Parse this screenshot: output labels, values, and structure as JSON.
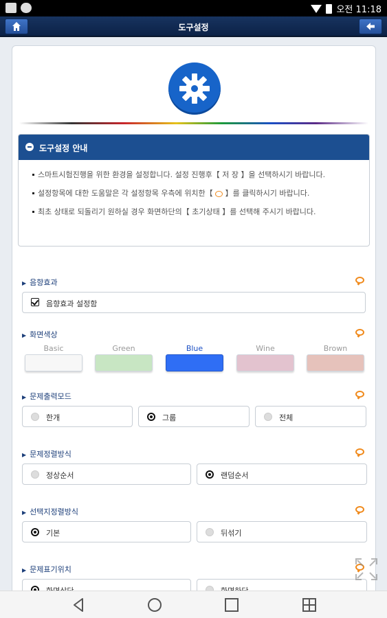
{
  "status_bar": {
    "time": "오전 11:18"
  },
  "header": {
    "title": "도구설정"
  },
  "guide": {
    "title": "도구설정 안내",
    "line1": "스마트시험진행을 위한 환경을 설정합니다. 설정 진행후【 저 장 】을 선택하시기 바랍니다.",
    "line2_a": "설정항목에 대한 도움말은 각 설정항목 우측에 위치한【",
    "line2_b": "】를 클릭하시기 바랍니다.",
    "line3": "최초 상태로 되돌리기 원하실 경우 화면하단의【 초기상태 】를 선택해 주시기 바랍니다."
  },
  "sections": {
    "sound": {
      "title": "음향효과",
      "option": "음향효과 설정함",
      "checked": true
    },
    "color": {
      "title": "화면색상",
      "options": [
        "Basic",
        "Green",
        "Blue",
        "Wine",
        "Brown"
      ],
      "selected": "Blue",
      "colors": {
        "basic": "#f7f7f7",
        "green": "#c8e6c3",
        "blue": "#2f6ef5",
        "wine": "#e3c3cf",
        "brown": "#e6c2bb"
      }
    },
    "output_mode": {
      "title": "문제출력모드",
      "options": [
        "한개",
        "그룹",
        "전체"
      ],
      "selected": "그룹"
    },
    "order": {
      "title": "문제정렬방식",
      "options": [
        "정상순서",
        "랜덤순서"
      ],
      "selected": "랜덤순서"
    },
    "choice_order": {
      "title": "선택지정렬방식",
      "options": [
        "기본",
        "뒤섞기"
      ],
      "selected": "기본"
    },
    "position": {
      "title": "문제표기위치",
      "options": [
        "화면상단",
        "화면하단"
      ]
    }
  }
}
